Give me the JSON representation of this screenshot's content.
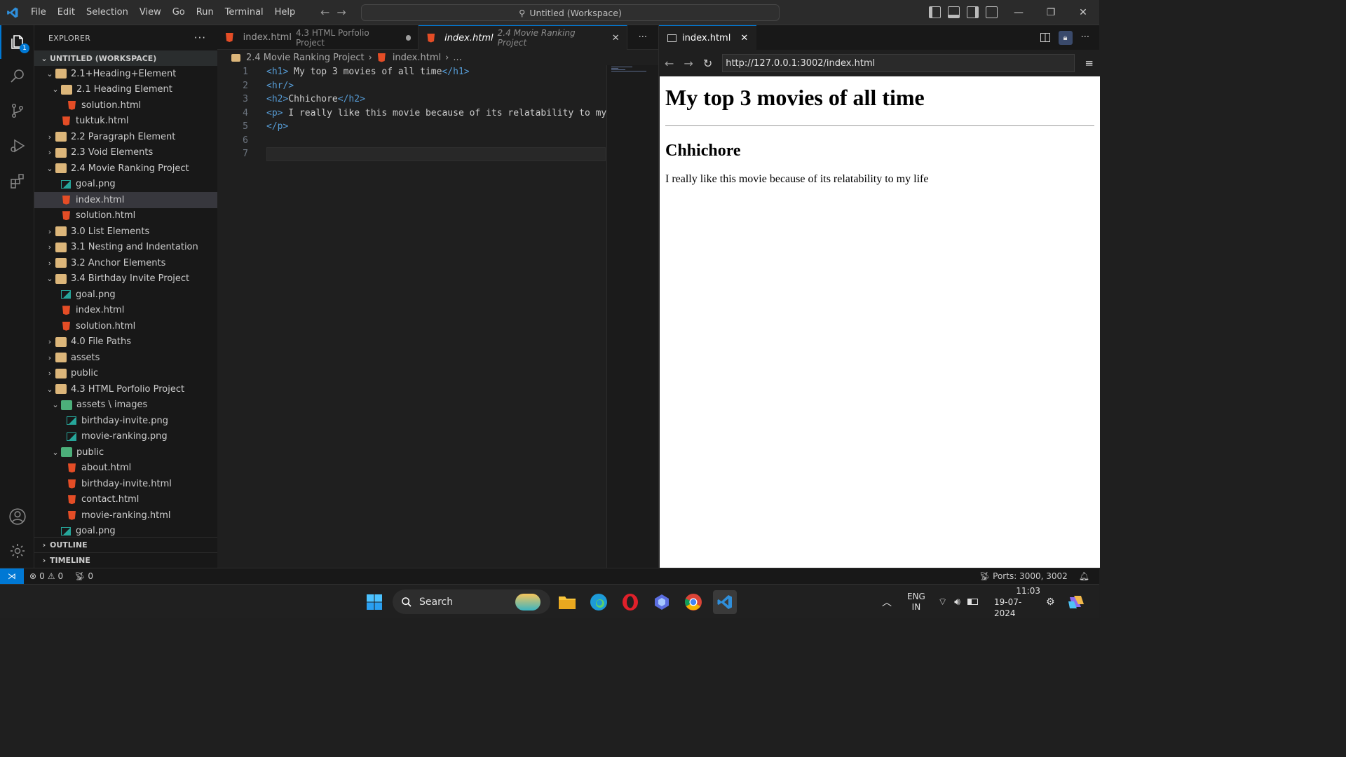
{
  "titlebar": {
    "menu": [
      "File",
      "Edit",
      "Selection",
      "View",
      "Go",
      "Run",
      "Terminal",
      "Help"
    ],
    "command_center": "Untitled (Workspace)"
  },
  "activity": {
    "explorer_badge": "1"
  },
  "explorer": {
    "title": "EXPLORER",
    "workspace": "UNTITLED (WORKSPACE)",
    "items": [
      {
        "label": "2.1+Heading+Element",
        "depth": 1,
        "kind": "folder",
        "expanded": true
      },
      {
        "label": "2.1 Heading Element",
        "depth": 2,
        "kind": "folder",
        "expanded": true
      },
      {
        "label": "solution.html",
        "depth": 3,
        "kind": "html"
      },
      {
        "label": "tuktuk.html",
        "depth": 2,
        "kind": "html"
      },
      {
        "label": "2.2 Paragraph Element",
        "depth": 1,
        "kind": "folder",
        "expanded": false
      },
      {
        "label": "2.3 Void Elements",
        "depth": 1,
        "kind": "folder",
        "expanded": false
      },
      {
        "label": "2.4 Movie Ranking Project",
        "depth": 1,
        "kind": "folder",
        "expanded": true
      },
      {
        "label": "goal.png",
        "depth": 2,
        "kind": "image"
      },
      {
        "label": "index.html",
        "depth": 2,
        "kind": "html",
        "selected": true
      },
      {
        "label": "solution.html",
        "depth": 2,
        "kind": "html"
      },
      {
        "label": "3.0 List Elements",
        "depth": 1,
        "kind": "folder",
        "expanded": false
      },
      {
        "label": "3.1 Nesting and Indentation",
        "depth": 1,
        "kind": "folder",
        "expanded": false
      },
      {
        "label": "3.2 Anchor Elements",
        "depth": 1,
        "kind": "folder",
        "expanded": false
      },
      {
        "label": "3.4 Birthday Invite Project",
        "depth": 1,
        "kind": "folder",
        "expanded": true
      },
      {
        "label": "goal.png",
        "depth": 2,
        "kind": "image"
      },
      {
        "label": "index.html",
        "depth": 2,
        "kind": "html"
      },
      {
        "label": "solution.html",
        "depth": 2,
        "kind": "html"
      },
      {
        "label": "4.0 File Paths",
        "depth": 1,
        "kind": "folder",
        "expanded": false
      },
      {
        "label": "assets",
        "depth": 1,
        "kind": "folder",
        "expanded": false
      },
      {
        "label": "public",
        "depth": 1,
        "kind": "folder",
        "expanded": false
      },
      {
        "label": "4.3 HTML Porfolio Project",
        "depth": 1,
        "kind": "folder",
        "expanded": true
      },
      {
        "label": "assets \\ images",
        "depth": 2,
        "kind": "folder-green",
        "expanded": true
      },
      {
        "label": "birthday-invite.png",
        "depth": 3,
        "kind": "image"
      },
      {
        "label": "movie-ranking.png",
        "depth": 3,
        "kind": "image"
      },
      {
        "label": "public",
        "depth": 2,
        "kind": "folder-green",
        "expanded": true
      },
      {
        "label": "about.html",
        "depth": 3,
        "kind": "html"
      },
      {
        "label": "birthday-invite.html",
        "depth": 3,
        "kind": "html"
      },
      {
        "label": "contact.html",
        "depth": 3,
        "kind": "html"
      },
      {
        "label": "movie-ranking.html",
        "depth": 3,
        "kind": "html"
      },
      {
        "label": "goal.png",
        "depth": 2,
        "kind": "image"
      }
    ],
    "outline": "OUTLINE",
    "timeline": "TIMELINE"
  },
  "editor": {
    "tabs": [
      {
        "name": "index.html",
        "desc": "4.3 HTML Porfolio Project",
        "active": false,
        "dirty": true
      },
      {
        "name": "index.html",
        "desc": "2.4 Movie Ranking Project",
        "active": true,
        "dirty": false
      }
    ],
    "breadcrumb": [
      "2.4 Movie Ranking Project",
      "index.html",
      "..."
    ],
    "lines": [
      {
        "num": "1",
        "html": "<span class=\"tag\">&lt;h1&gt;</span> My top 3 movies of all time<span class=\"tag\">&lt;/h1&gt;</span>"
      },
      {
        "num": "2",
        "html": "<span class=\"tag\">&lt;hr/&gt;</span>"
      },
      {
        "num": "3",
        "html": "<span class=\"tag\">&lt;h2&gt;</span>Chhichore<span class=\"tag\">&lt;/h2&gt;</span>"
      },
      {
        "num": "4",
        "html": "<span class=\"tag\">&lt;p&gt;</span> I really like this movie because of its relatability to my"
      },
      {
        "num": "5",
        "html": "<span class=\"tag\">&lt;/p&gt;</span>"
      },
      {
        "num": "6",
        "html": ""
      },
      {
        "num": "7",
        "html": ""
      }
    ]
  },
  "browser": {
    "tab_title": "index.html",
    "url": "http://127.0.0.1:3002/index.html",
    "page": {
      "h1": "My top 3 movies of all time",
      "h2": "Chhichore",
      "p": "I really like this movie because of its relatability to my life"
    }
  },
  "statusbar": {
    "errors": "0",
    "warnings": "0",
    "ports_count": "0",
    "ports": "Ports: 3000, 3002"
  },
  "taskbar": {
    "search": "Search",
    "lang_top": "ENG",
    "lang_bottom": "IN",
    "time": "11:03",
    "date": "19-07-2024"
  }
}
